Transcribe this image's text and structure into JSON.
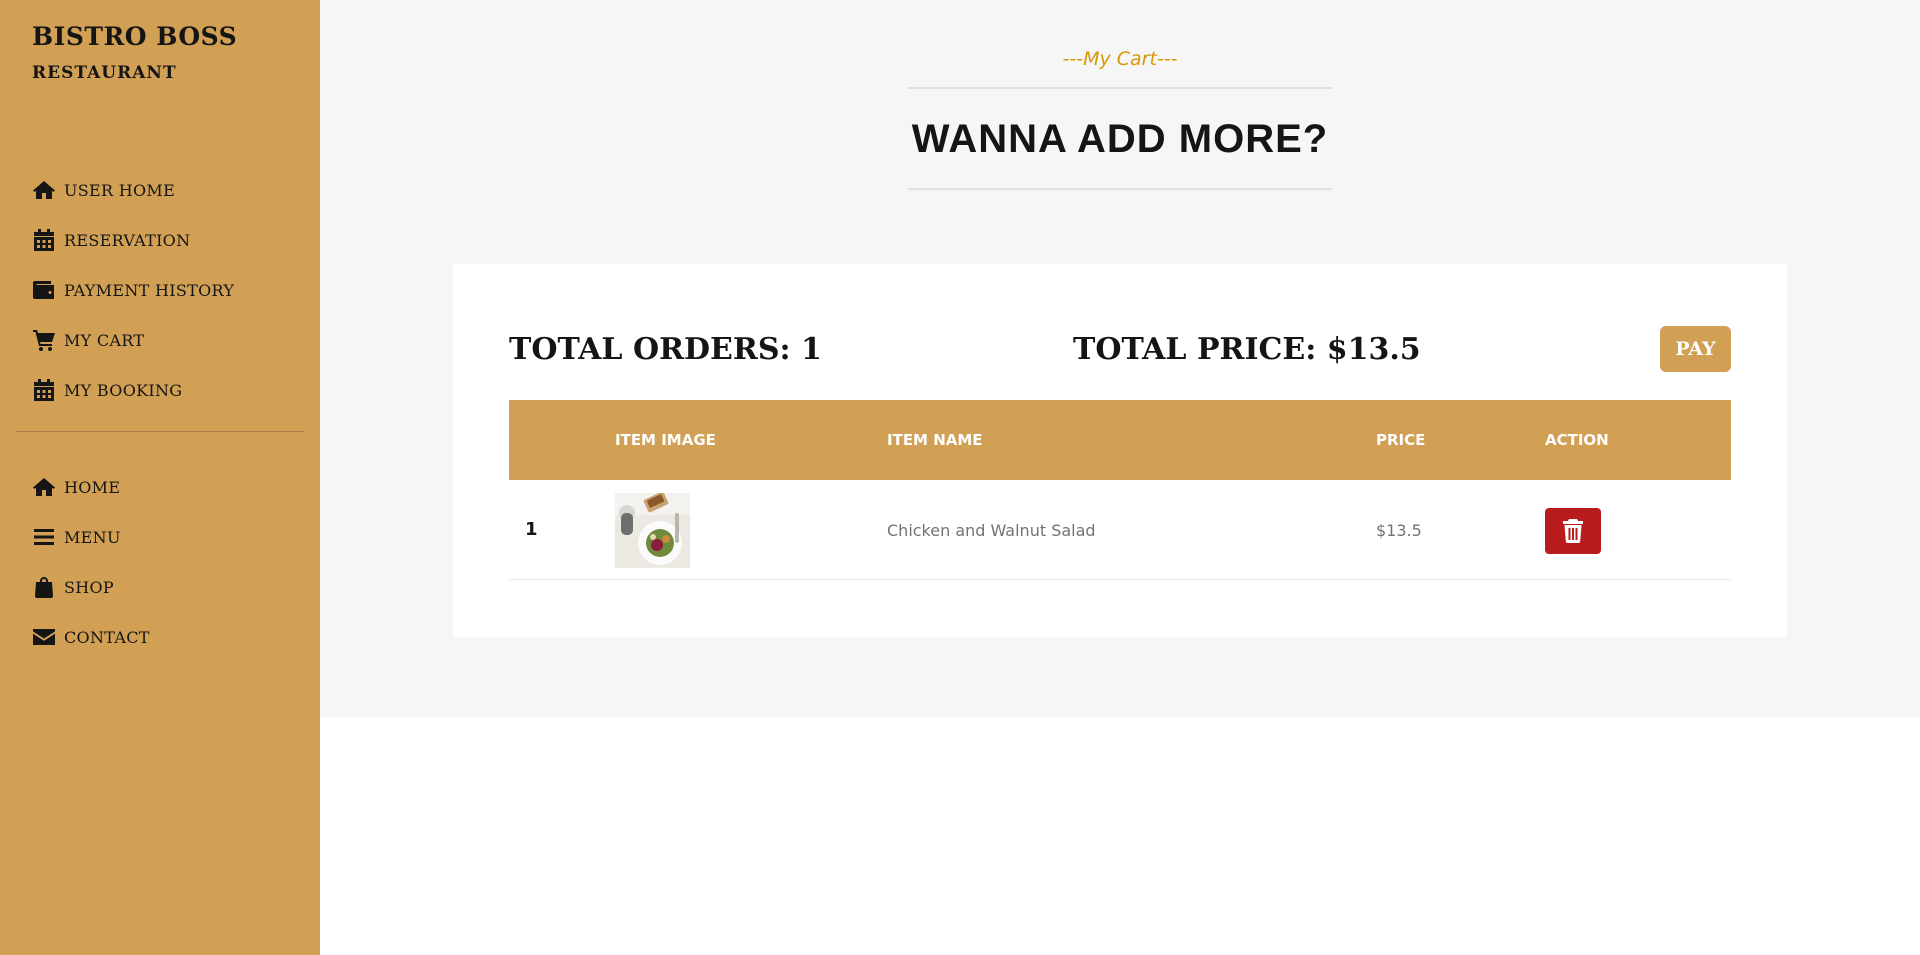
{
  "brand": {
    "title": "BISTRO BOSS",
    "subtitle": "RESTAURANT"
  },
  "sidebar": {
    "top_items": [
      {
        "label": "USER HOME",
        "icon": "home-icon"
      },
      {
        "label": "RESERVATION",
        "icon": "calendar-icon"
      },
      {
        "label": "PAYMENT HISTORY",
        "icon": "wallet-icon"
      },
      {
        "label": "MY CART",
        "icon": "cart-icon"
      },
      {
        "label": "MY BOOKING",
        "icon": "calendar-icon"
      }
    ],
    "bottom_items": [
      {
        "label": "HOME",
        "icon": "home-icon"
      },
      {
        "label": "MENU",
        "icon": "menu-icon"
      },
      {
        "label": "SHOP",
        "icon": "shopping-bag-icon"
      },
      {
        "label": "CONTACT",
        "icon": "envelope-icon"
      }
    ]
  },
  "section": {
    "subheading": "---My Cart---",
    "heading": "WANNA ADD MORE?"
  },
  "summary": {
    "total_orders": "TOTAL ORDERS: 1",
    "total_price": "TOTAL PRICE: $13.5",
    "pay_label": "PAY"
  },
  "table": {
    "headers": [
      "",
      "ITEM IMAGE",
      "ITEM NAME",
      "PRICE",
      "ACTION"
    ],
    "rows": [
      {
        "index": "1",
        "name": "Chicken and Walnut Salad",
        "price": "$13.5",
        "action_icon": "trash-icon"
      }
    ]
  },
  "colors": {
    "sidebar": "#D1A054",
    "accent": "#D99904",
    "delete": "#B91C1C",
    "background": "#F6F6F6"
  }
}
